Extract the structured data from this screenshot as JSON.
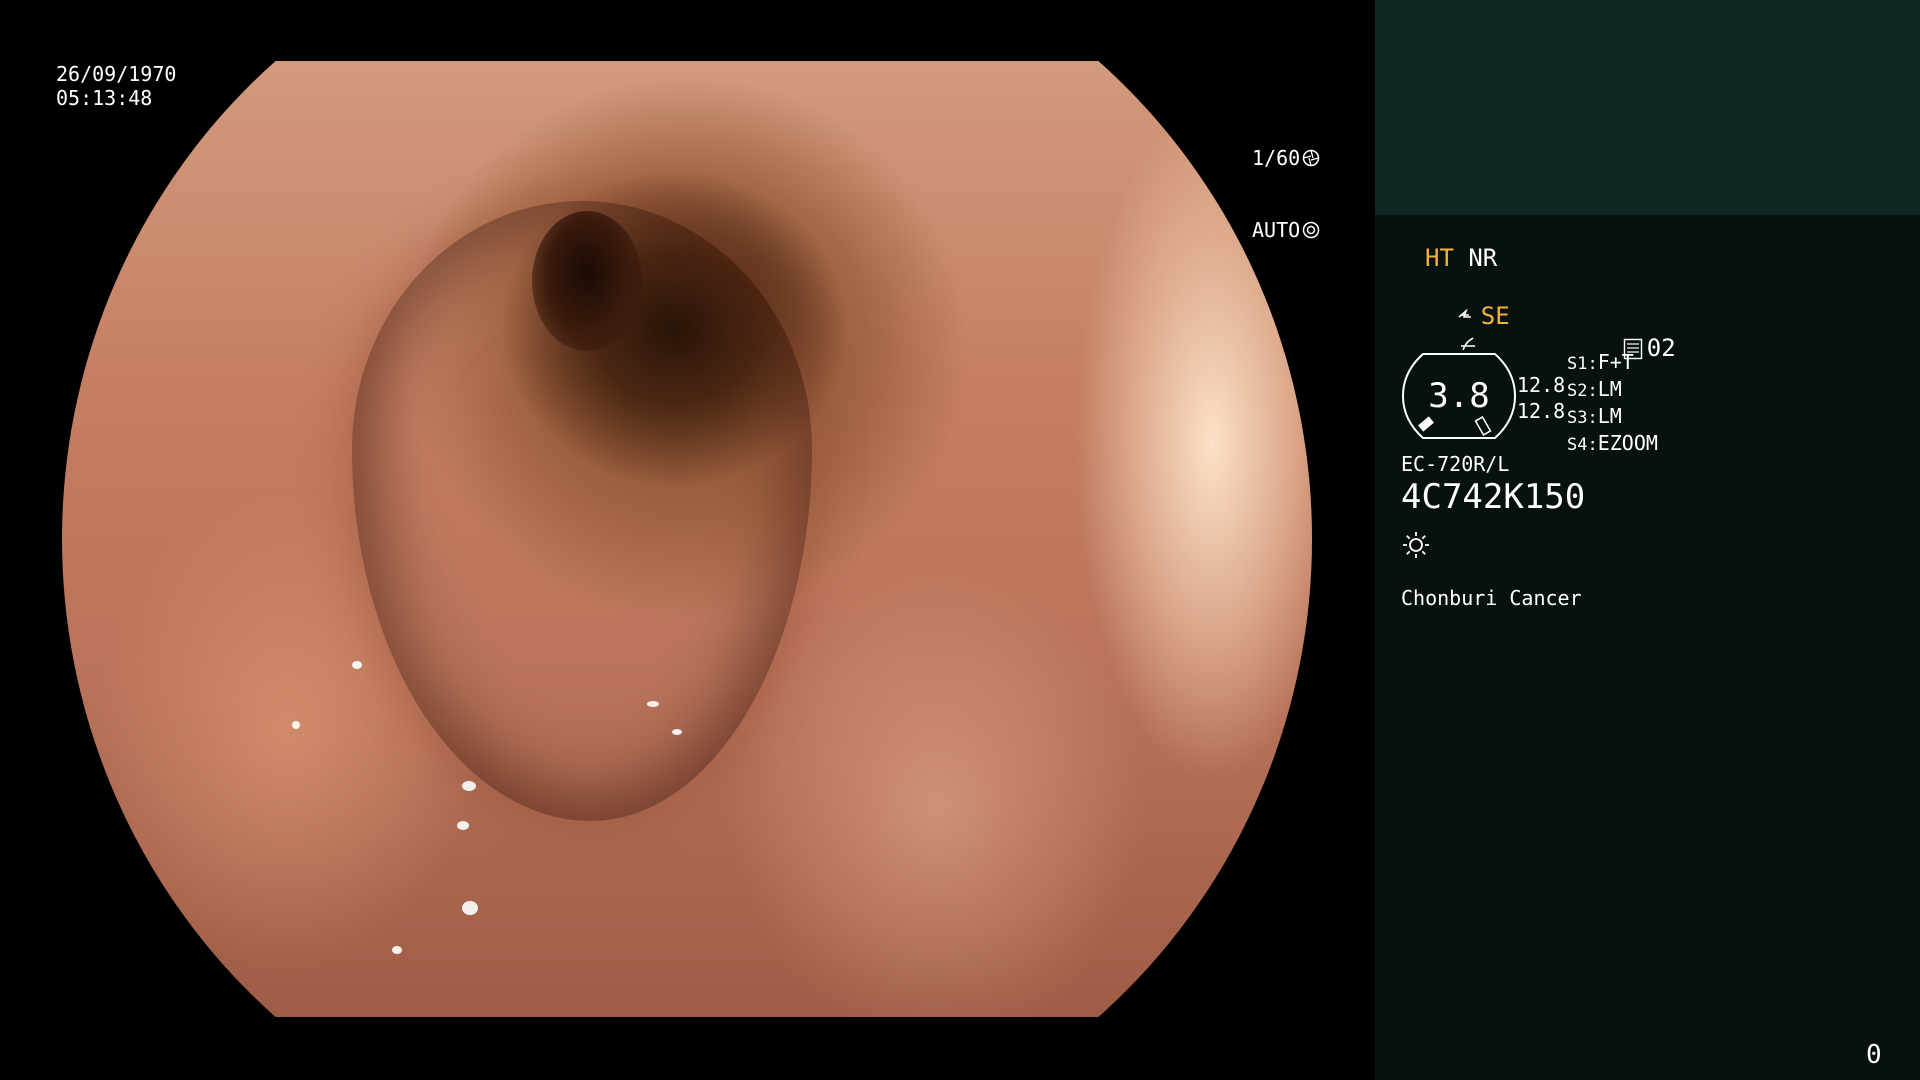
{
  "overlay": {
    "date": "26/09/1970",
    "time": "05:13:48",
    "shutter_speed": "1/60",
    "iris_mode": "AUTO"
  },
  "panel": {
    "ht_label": "HT",
    "nr_label": "NR",
    "se_label": "SE",
    "preset_number": "02",
    "gauge_value": "3.8",
    "gauge_side_values": [
      "12.8",
      "12.8"
    ],
    "switches": [
      {
        "key": "S1:",
        "value": "F+T"
      },
      {
        "key": "S2:",
        "value": "LM"
      },
      {
        "key": "S3:",
        "value": "LM"
      },
      {
        "key": "S4:",
        "value": "EZOOM"
      }
    ],
    "scope_model": "EC-720R/L",
    "scope_serial": "4C742K150",
    "hospital_name": "Chonburi Cancer",
    "frame_counter": "0"
  },
  "colors": {
    "accent_yellow": "#f5b335",
    "panel_bg": "#07120f",
    "panel_top_bg": "#0e2624"
  },
  "icons": [
    "shutter-icon",
    "iris-icon",
    "structure-enhance-icon",
    "freeze-icon",
    "preset-icon",
    "brightness-icon"
  ]
}
